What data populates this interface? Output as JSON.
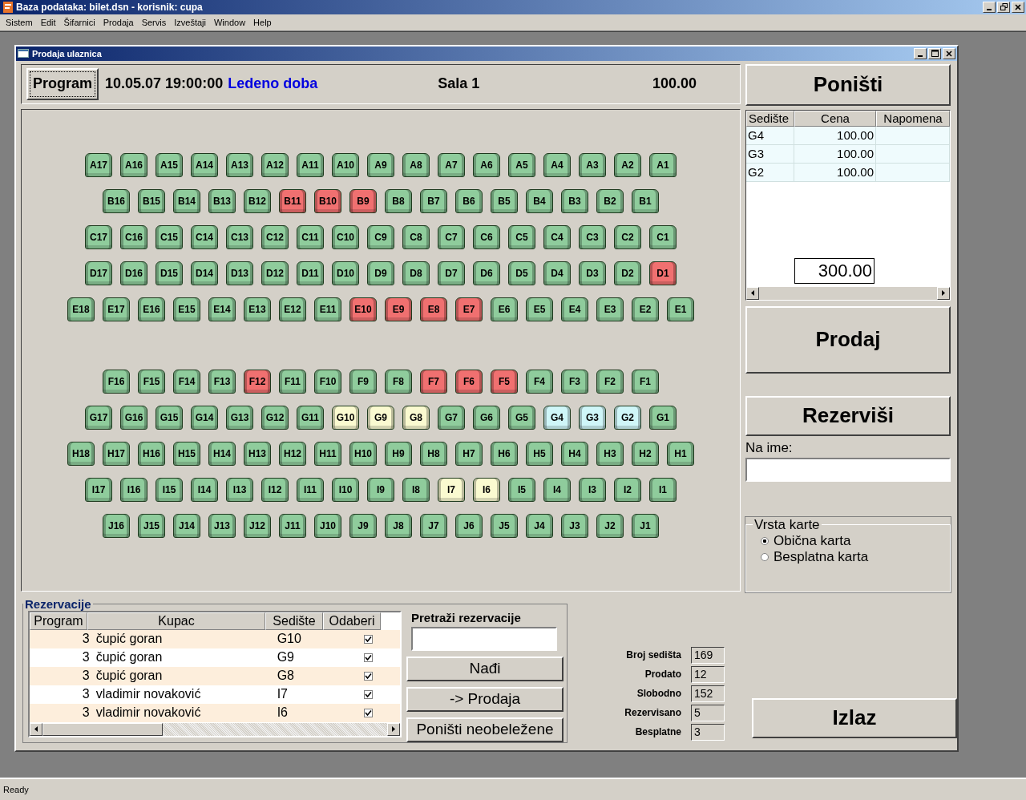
{
  "app_window": {
    "title": "Baza podataka: bilet.dsn  -  korisnik: cupa"
  },
  "menu": [
    "Sistem",
    "Edit",
    "Šifarnici",
    "Prodaja",
    "Servis",
    "Izveštaji",
    "Window",
    "Help"
  ],
  "child_window": {
    "title": "Prodaja ulaznica"
  },
  "info_bar": {
    "program_button": "Program",
    "datetime": "10.05.07 19:00:00",
    "movie": "Ledeno doba",
    "hall": "Sala 1",
    "price": "100.00"
  },
  "seat_map": {
    "sections": [
      {
        "rows": [
          {
            "seats": [
              {
                "label": "A17",
                "kind": "free"
              },
              {
                "label": "A16",
                "kind": "free"
              },
              {
                "label": "A15",
                "kind": "free"
              },
              {
                "label": "A14",
                "kind": "free"
              },
              {
                "label": "A13",
                "kind": "free"
              },
              {
                "label": "A12",
                "kind": "free"
              },
              {
                "label": "A11",
                "kind": "free"
              },
              {
                "label": "A10",
                "kind": "free"
              },
              {
                "label": "A9",
                "kind": "free"
              },
              {
                "label": "A8",
                "kind": "free"
              },
              {
                "label": "A7",
                "kind": "free"
              },
              {
                "label": "A6",
                "kind": "free"
              },
              {
                "label": "A5",
                "kind": "free"
              },
              {
                "label": "A4",
                "kind": "free"
              },
              {
                "label": "A3",
                "kind": "free"
              },
              {
                "label": "A2",
                "kind": "free"
              },
              {
                "label": "A1",
                "kind": "free"
              }
            ]
          },
          {
            "seats": [
              {
                "label": "B16",
                "kind": "free"
              },
              {
                "label": "B15",
                "kind": "free"
              },
              {
                "label": "B14",
                "kind": "free"
              },
              {
                "label": "B13",
                "kind": "free"
              },
              {
                "label": "B12",
                "kind": "free"
              },
              {
                "label": "B11",
                "kind": "sold"
              },
              {
                "label": "B10",
                "kind": "sold"
              },
              {
                "label": "B9",
                "kind": "sold"
              },
              {
                "label": "B8",
                "kind": "free"
              },
              {
                "label": "B7",
                "kind": "free"
              },
              {
                "label": "B6",
                "kind": "free"
              },
              {
                "label": "B5",
                "kind": "free"
              },
              {
                "label": "B4",
                "kind": "free"
              },
              {
                "label": "B3",
                "kind": "free"
              },
              {
                "label": "B2",
                "kind": "free"
              },
              {
                "label": "B1",
                "kind": "free"
              }
            ]
          },
          {
            "seats": [
              {
                "label": "C17",
                "kind": "free"
              },
              {
                "label": "C16",
                "kind": "free"
              },
              {
                "label": "C15",
                "kind": "free"
              },
              {
                "label": "C14",
                "kind": "free"
              },
              {
                "label": "C13",
                "kind": "free"
              },
              {
                "label": "C12",
                "kind": "free"
              },
              {
                "label": "C11",
                "kind": "free"
              },
              {
                "label": "C10",
                "kind": "free"
              },
              {
                "label": "C9",
                "kind": "free"
              },
              {
                "label": "C8",
                "kind": "free"
              },
              {
                "label": "C7",
                "kind": "free"
              },
              {
                "label": "C6",
                "kind": "free"
              },
              {
                "label": "C5",
                "kind": "free"
              },
              {
                "label": "C4",
                "kind": "free"
              },
              {
                "label": "C3",
                "kind": "free"
              },
              {
                "label": "C2",
                "kind": "free"
              },
              {
                "label": "C1",
                "kind": "free"
              }
            ]
          },
          {
            "seats": [
              {
                "label": "D17",
                "kind": "free"
              },
              {
                "label": "D16",
                "kind": "free"
              },
              {
                "label": "D15",
                "kind": "free"
              },
              {
                "label": "D14",
                "kind": "free"
              },
              {
                "label": "D13",
                "kind": "free"
              },
              {
                "label": "D12",
                "kind": "free"
              },
              {
                "label": "D11",
                "kind": "free"
              },
              {
                "label": "D10",
                "kind": "free"
              },
              {
                "label": "D9",
                "kind": "free"
              },
              {
                "label": "D8",
                "kind": "free"
              },
              {
                "label": "D7",
                "kind": "free"
              },
              {
                "label": "D6",
                "kind": "free"
              },
              {
                "label": "D5",
                "kind": "free"
              },
              {
                "label": "D4",
                "kind": "free"
              },
              {
                "label": "D3",
                "kind": "free"
              },
              {
                "label": "D2",
                "kind": "free"
              },
              {
                "label": "D1",
                "kind": "sold"
              }
            ]
          },
          {
            "seats": [
              {
                "label": "E18",
                "kind": "free"
              },
              {
                "label": "E17",
                "kind": "free"
              },
              {
                "label": "E16",
                "kind": "free"
              },
              {
                "label": "E15",
                "kind": "free"
              },
              {
                "label": "E14",
                "kind": "free"
              },
              {
                "label": "E13",
                "kind": "free"
              },
              {
                "label": "E12",
                "kind": "free"
              },
              {
                "label": "E11",
                "kind": "free"
              },
              {
                "label": "E10",
                "kind": "sold"
              },
              {
                "label": "E9",
                "kind": "sold"
              },
              {
                "label": "E8",
                "kind": "sold"
              },
              {
                "label": "E7",
                "kind": "sold"
              },
              {
                "label": "E6",
                "kind": "free"
              },
              {
                "label": "E5",
                "kind": "free"
              },
              {
                "label": "E4",
                "kind": "free"
              },
              {
                "label": "E3",
                "kind": "free"
              },
              {
                "label": "E2",
                "kind": "free"
              },
              {
                "label": "E1",
                "kind": "free"
              }
            ]
          }
        ]
      },
      {
        "rows": [
          {
            "seats": [
              {
                "label": "F16",
                "kind": "free"
              },
              {
                "label": "F15",
                "kind": "free"
              },
              {
                "label": "F14",
                "kind": "free"
              },
              {
                "label": "F13",
                "kind": "free"
              },
              {
                "label": "F12",
                "kind": "sold"
              },
              {
                "label": "F11",
                "kind": "free"
              },
              {
                "label": "F10",
                "kind": "free"
              },
              {
                "label": "F9",
                "kind": "free"
              },
              {
                "label": "F8",
                "kind": "free"
              },
              {
                "label": "F7",
                "kind": "sold"
              },
              {
                "label": "F6",
                "kind": "sold"
              },
              {
                "label": "F5",
                "kind": "sold"
              },
              {
                "label": "F4",
                "kind": "free"
              },
              {
                "label": "F3",
                "kind": "free"
              },
              {
                "label": "F2",
                "kind": "free"
              },
              {
                "label": "F1",
                "kind": "free"
              }
            ]
          },
          {
            "seats": [
              {
                "label": "G17",
                "kind": "free"
              },
              {
                "label": "G16",
                "kind": "free"
              },
              {
                "label": "G15",
                "kind": "free"
              },
              {
                "label": "G14",
                "kind": "free"
              },
              {
                "label": "G13",
                "kind": "free"
              },
              {
                "label": "G12",
                "kind": "free"
              },
              {
                "label": "G11",
                "kind": "free"
              },
              {
                "label": "G10",
                "kind": "reserved"
              },
              {
                "label": "G9",
                "kind": "reserved"
              },
              {
                "label": "G8",
                "kind": "reserved"
              },
              {
                "label": "G7",
                "kind": "free"
              },
              {
                "label": "G6",
                "kind": "free"
              },
              {
                "label": "G5",
                "kind": "free"
              },
              {
                "label": "G4",
                "kind": "selected"
              },
              {
                "label": "G3",
                "kind": "selected"
              },
              {
                "label": "G2",
                "kind": "selected"
              },
              {
                "label": "G1",
                "kind": "free"
              }
            ]
          },
          {
            "seats": [
              {
                "label": "H18",
                "kind": "free"
              },
              {
                "label": "H17",
                "kind": "free"
              },
              {
                "label": "H16",
                "kind": "free"
              },
              {
                "label": "H15",
                "kind": "free"
              },
              {
                "label": "H14",
                "kind": "free"
              },
              {
                "label": "H13",
                "kind": "free"
              },
              {
                "label": "H12",
                "kind": "free"
              },
              {
                "label": "H11",
                "kind": "free"
              },
              {
                "label": "H10",
                "kind": "free"
              },
              {
                "label": "H9",
                "kind": "free"
              },
              {
                "label": "H8",
                "kind": "free"
              },
              {
                "label": "H7",
                "kind": "free"
              },
              {
                "label": "H6",
                "kind": "free"
              },
              {
                "label": "H5",
                "kind": "free"
              },
              {
                "label": "H4",
                "kind": "free"
              },
              {
                "label": "H3",
                "kind": "free"
              },
              {
                "label": "H2",
                "kind": "free"
              },
              {
                "label": "H1",
                "kind": "free"
              }
            ]
          },
          {
            "seats": [
              {
                "label": "I17",
                "kind": "free"
              },
              {
                "label": "I16",
                "kind": "free"
              },
              {
                "label": "I15",
                "kind": "free"
              },
              {
                "label": "I14",
                "kind": "free"
              },
              {
                "label": "I13",
                "kind": "free"
              },
              {
                "label": "I12",
                "kind": "free"
              },
              {
                "label": "I11",
                "kind": "free"
              },
              {
                "label": "I10",
                "kind": "free"
              },
              {
                "label": "I9",
                "kind": "free"
              },
              {
                "label": "I8",
                "kind": "free"
              },
              {
                "label": "I7",
                "kind": "reserved"
              },
              {
                "label": "I6",
                "kind": "reserved"
              },
              {
                "label": "I5",
                "kind": "free"
              },
              {
                "label": "I4",
                "kind": "free"
              },
              {
                "label": "I3",
                "kind": "free"
              },
              {
                "label": "I2",
                "kind": "free"
              },
              {
                "label": "I1",
                "kind": "free"
              }
            ]
          },
          {
            "seats": [
              {
                "label": "J16",
                "kind": "free"
              },
              {
                "label": "J15",
                "kind": "free"
              },
              {
                "label": "J14",
                "kind": "free"
              },
              {
                "label": "J13",
                "kind": "free"
              },
              {
                "label": "J12",
                "kind": "free"
              },
              {
                "label": "J11",
                "kind": "free"
              },
              {
                "label": "J10",
                "kind": "free"
              },
              {
                "label": "J9",
                "kind": "free"
              },
              {
                "label": "J8",
                "kind": "free"
              },
              {
                "label": "J7",
                "kind": "free"
              },
              {
                "label": "J6",
                "kind": "free"
              },
              {
                "label": "J5",
                "kind": "free"
              },
              {
                "label": "J4",
                "kind": "free"
              },
              {
                "label": "J3",
                "kind": "free"
              },
              {
                "label": "J2",
                "kind": "free"
              },
              {
                "label": "J1",
                "kind": "free"
              }
            ]
          }
        ]
      }
    ]
  },
  "cancel_button": "Poništi",
  "cart": {
    "columns": [
      "Sedište",
      "Cena",
      "Napomena"
    ],
    "rows": [
      {
        "seat": "G4",
        "price": "100.00"
      },
      {
        "seat": "G3",
        "price": "100.00"
      },
      {
        "seat": "G2",
        "price": "100.00"
      }
    ],
    "total": "300.00"
  },
  "sell_button": "Prodaj",
  "reserve_button": "Rezerviši",
  "name_field": {
    "label": "Na ime:"
  },
  "ticket_type": {
    "title": "Vrsta karte",
    "options": [
      {
        "label": "Obična karta",
        "selected": true
      },
      {
        "label": "Besplatna karta",
        "selected": false
      }
    ]
  },
  "reservations": {
    "title": "Rezervacije",
    "columns": [
      "Program",
      "Kupac",
      "Sedište",
      "Odaberi"
    ],
    "rows": [
      {
        "program": "3",
        "customer": "čupić goran",
        "seat": "G10",
        "checked": true
      },
      {
        "program": "3",
        "customer": "čupić goran",
        "seat": "G9",
        "checked": true
      },
      {
        "program": "3",
        "customer": "čupić goran",
        "seat": "G8",
        "checked": true
      },
      {
        "program": "3",
        "customer": "vladimir novaković",
        "seat": "I7",
        "checked": true
      },
      {
        "program": "3",
        "customer": "vladimir novaković",
        "seat": "I6",
        "checked": true
      }
    ],
    "search_label": "Pretraži rezervacije",
    "find_button": "Nađi",
    "to_sale_button": "-> Prodaja",
    "cancel_unmarked_button": "Poništi neobeležene"
  },
  "stats": [
    {
      "label": "Broj sedišta",
      "value": "169"
    },
    {
      "label": "Prodato",
      "value": "12"
    },
    {
      "label": "Slobodno",
      "value": "152"
    },
    {
      "label": "Rezervisano",
      "value": "5"
    },
    {
      "label": "Besplatne",
      "value": "3"
    }
  ],
  "exit_button": "Izlaz",
  "status_bar": "Ready"
}
